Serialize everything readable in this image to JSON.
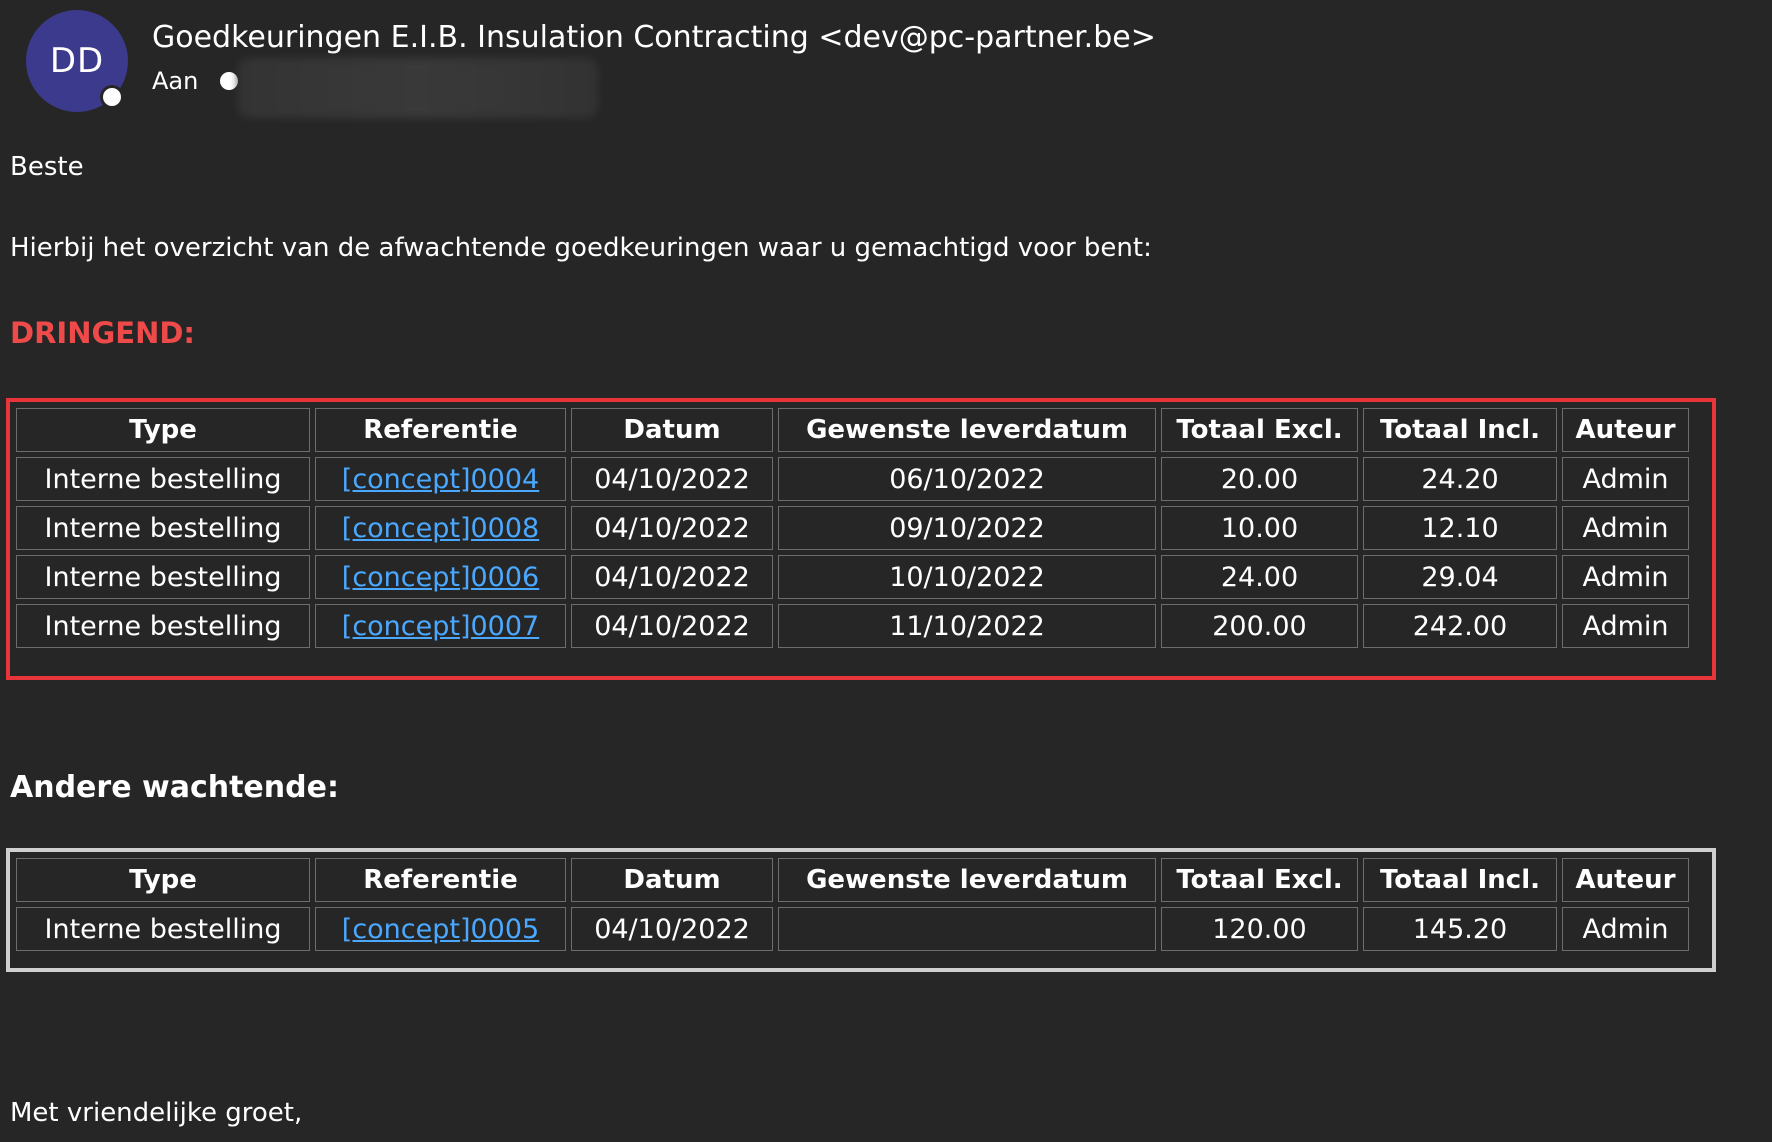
{
  "email": {
    "avatar_initials": "DD",
    "sender": "Goedkeuringen E.I.B. Insulation Contracting <dev@pc-partner.be>",
    "to_label": "Aan",
    "greeting": "Beste",
    "intro": "Hierbij het overzicht van de afwachtende goedkeuringen waar u gemachtigd voor bent:",
    "urgent_heading": "DRINGEND:",
    "other_heading": "Andere wachtende:",
    "closing": "Met vriendelijke groet,"
  },
  "columns": [
    "Type",
    "Referentie",
    "Datum",
    "Gewenste leverdatum",
    "Totaal Excl.",
    "Totaal Incl.",
    "Auteur"
  ],
  "urgent_rows": [
    [
      "Interne bestelling",
      "[concept]0004",
      "04/10/2022",
      "06/10/2022",
      "20.00",
      "24.20",
      "Admin"
    ],
    [
      "Interne bestelling",
      "[concept]0008",
      "04/10/2022",
      "09/10/2022",
      "10.00",
      "12.10",
      "Admin"
    ],
    [
      "Interne bestelling",
      "[concept]0006",
      "04/10/2022",
      "10/10/2022",
      "24.00",
      "29.04",
      "Admin"
    ],
    [
      "Interne bestelling",
      "[concept]0007",
      "04/10/2022",
      "11/10/2022",
      "200.00",
      "242.00",
      "Admin"
    ]
  ],
  "other_rows": [
    [
      "Interne bestelling",
      "[concept]0005",
      "04/10/2022",
      "",
      "120.00",
      "145.20",
      "Admin"
    ]
  ],
  "colors": {
    "background": "#262626",
    "urgent": "#ef4a4a",
    "link": "#4aa8ff",
    "avatar": "#3b3a8c"
  }
}
